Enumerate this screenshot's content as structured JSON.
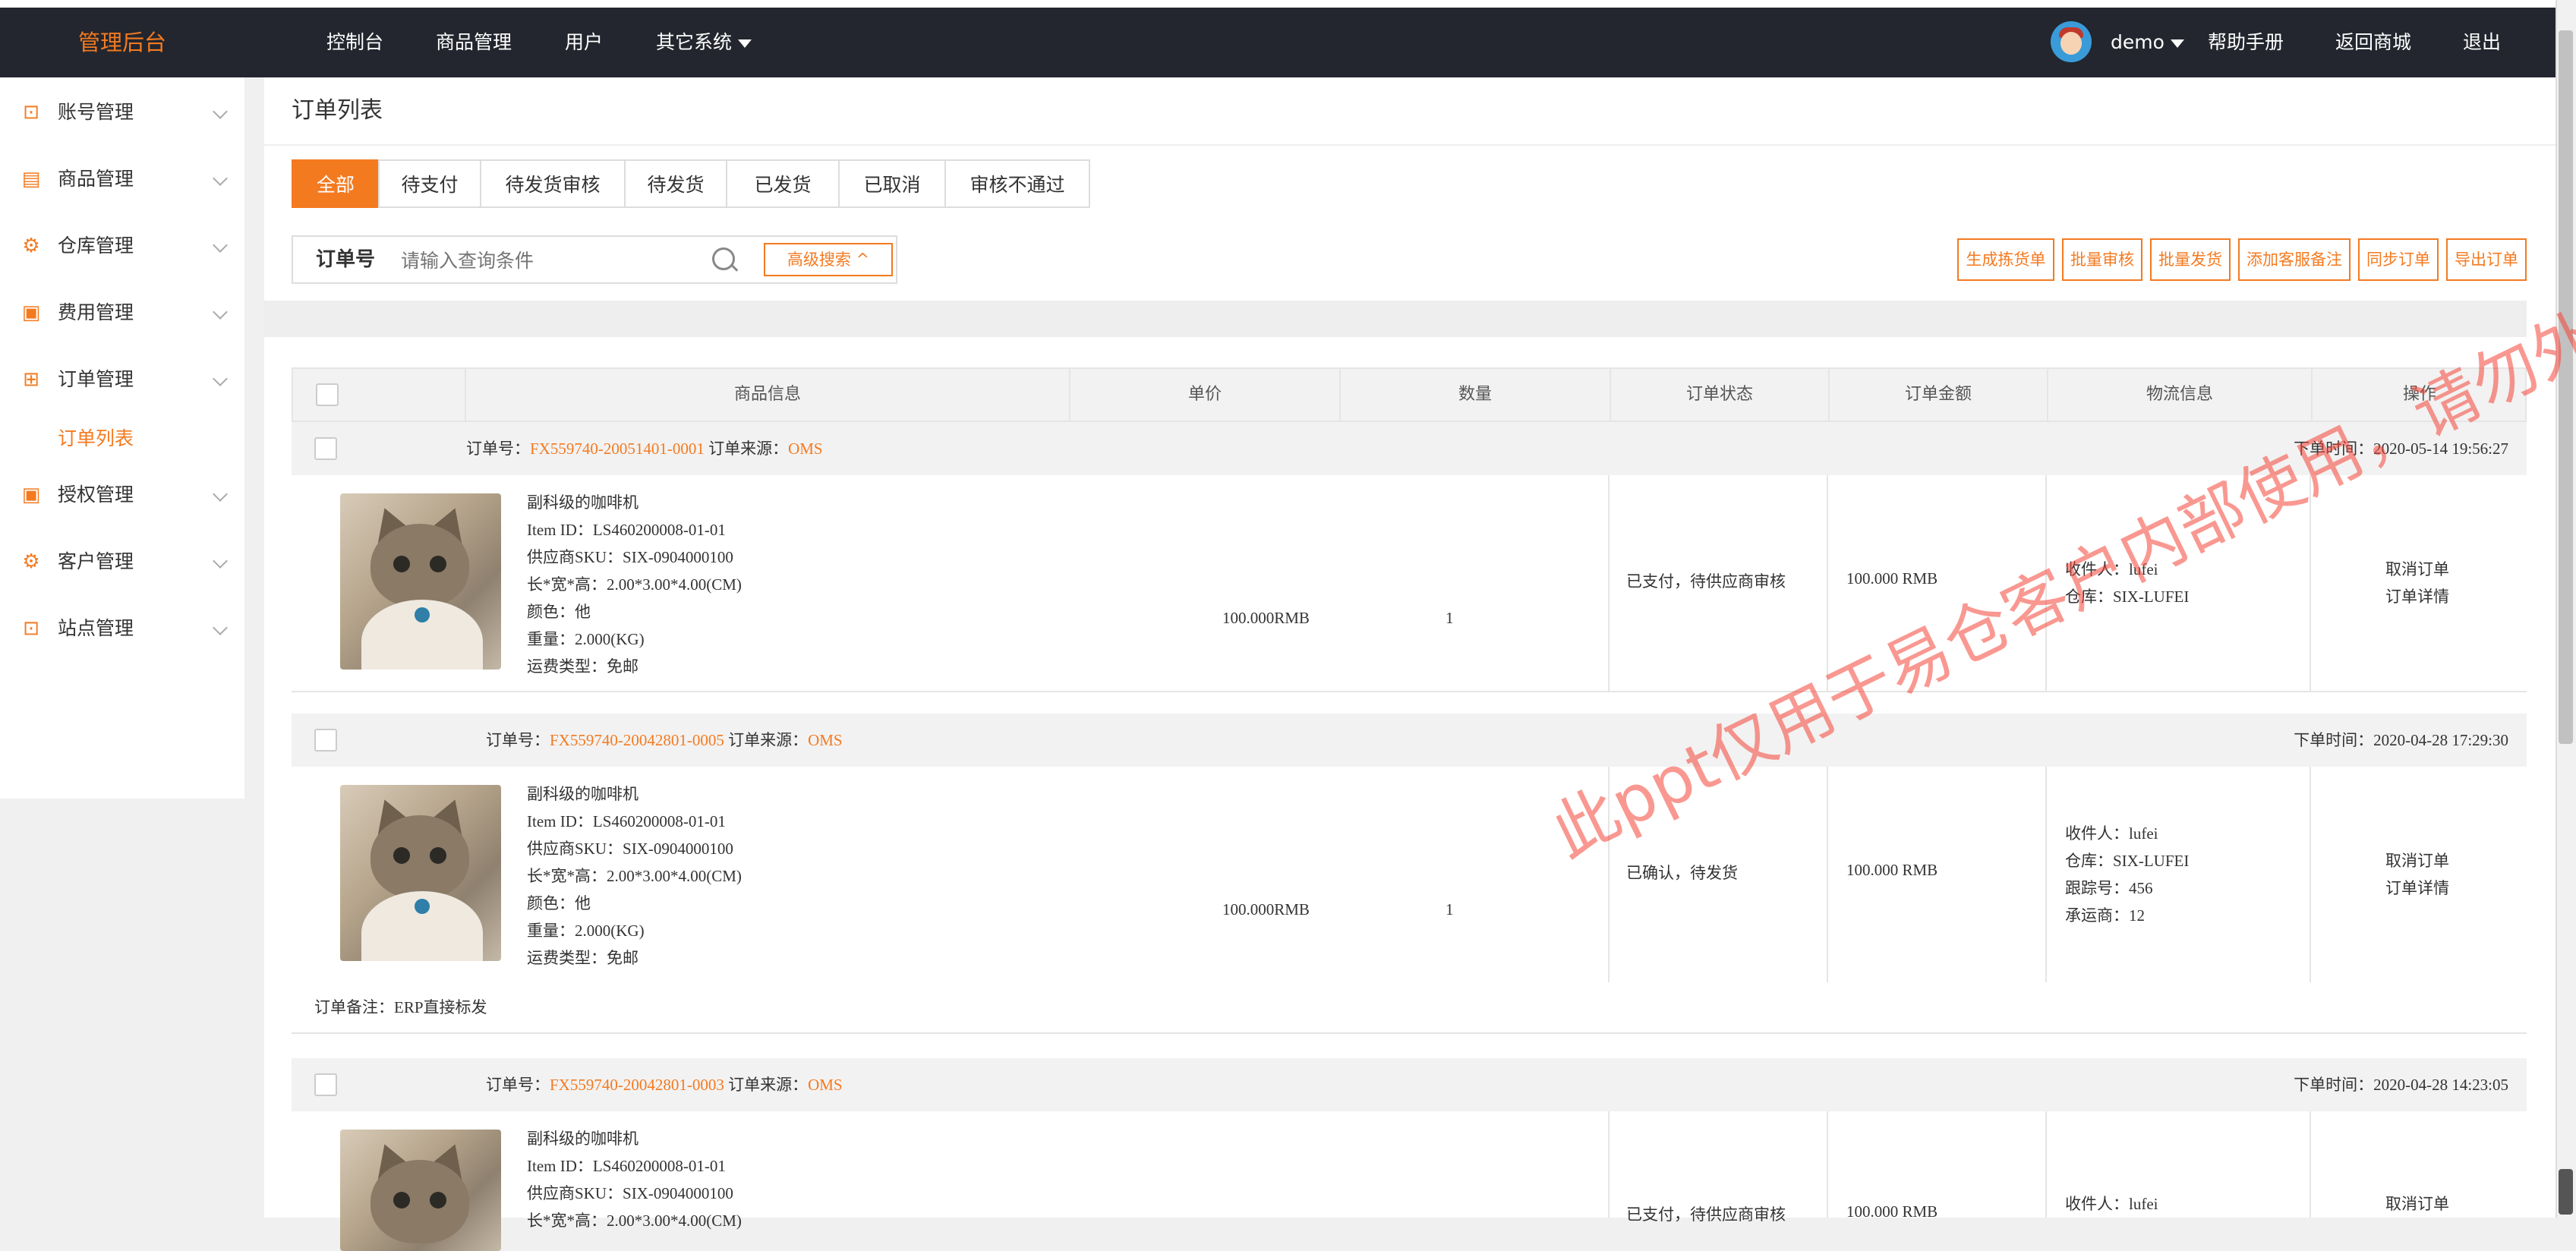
{
  "header": {
    "brand": "管理后台",
    "nav": [
      "控制台",
      "商品管理",
      "用户",
      "其它系统"
    ],
    "user": "demo",
    "help": "帮助手册",
    "back_mall": "返回商城",
    "logout": "退出"
  },
  "sidebar": {
    "items": [
      {
        "label": "账号管理",
        "icon": "chart-icon"
      },
      {
        "label": "商品管理",
        "icon": "id-card-icon"
      },
      {
        "label": "仓库管理",
        "icon": "gear-icon"
      },
      {
        "label": "费用管理",
        "icon": "calendar-icon"
      },
      {
        "label": "订单管理",
        "icon": "gift-icon"
      },
      {
        "label": "授权管理",
        "icon": "calendar-icon"
      },
      {
        "label": "客户管理",
        "icon": "gear-icon"
      },
      {
        "label": "站点管理",
        "icon": "chart-icon"
      }
    ],
    "active_sub": "订单列表"
  },
  "page": {
    "title": "订单列表"
  },
  "tabs": [
    "全部",
    "待支付",
    "待发货审核",
    "待发货",
    "已发货",
    "已取消",
    "审核不通过"
  ],
  "search": {
    "label": "订单号",
    "placeholder": "请输入查询条件",
    "advanced": "高级搜索 ^"
  },
  "actions": [
    "生成拣货单",
    "批量审核",
    "批量发货",
    "添加客服备注",
    "同步订单",
    "导出订单"
  ],
  "table": {
    "headers": [
      "商品信息",
      "单价",
      "数量",
      "订单状态",
      "订单金额",
      "物流信息",
      "操作"
    ]
  },
  "labels": {
    "order_no": "订单号：",
    "order_source": " 订单来源：",
    "order_time": "下单时间：",
    "cancel": "取消订单",
    "detail": "订单详情"
  },
  "orders": [
    {
      "order_no": "FX559740-20051401-0001",
      "source": "OMS",
      "time": "2020-05-14 19:56:27",
      "product": {
        "name": "副科级的咖啡机",
        "item_id": "Item ID：LS460200008-01-01",
        "sku": "供应商SKU：SIX-0904000100",
        "dims": "长*宽*高：2.00*3.00*4.00(CM)",
        "color": "颜色：他",
        "weight": "重量：2.000(KG)",
        "shipping": "运费类型：免邮"
      },
      "price": "100.000RMB",
      "qty": "1",
      "status": "已支付，待供应商审核",
      "amount": "100.000 RMB",
      "logistics": [
        "收件人：lufei",
        "仓库：SIX-LUFEI"
      ]
    },
    {
      "order_no": "FX559740-20042801-0005",
      "source": "OMS",
      "time": "2020-04-28 17:29:30",
      "product": {
        "name": "副科级的咖啡机",
        "item_id": "Item ID：LS460200008-01-01",
        "sku": "供应商SKU：SIX-0904000100",
        "dims": "长*宽*高：2.00*3.00*4.00(CM)",
        "color": "颜色：他",
        "weight": "重量：2.000(KG)",
        "shipping": "运费类型：免邮"
      },
      "price": "100.000RMB",
      "qty": "1",
      "status": "已确认，待发货",
      "amount": "100.000 RMB",
      "logistics": [
        "收件人：lufei",
        "仓库：SIX-LUFEI",
        "跟踪号：456",
        "承运商：12"
      ],
      "remark": "订单备注：ERP直接标发"
    },
    {
      "order_no": "FX559740-20042801-0003",
      "source": "OMS",
      "time": "2020-04-28 14:23:05",
      "product": {
        "name": "副科级的咖啡机",
        "item_id": "Item ID：LS460200008-01-01",
        "sku": "供应商SKU：SIX-0904000100",
        "dims": "长*宽*高：2.00*3.00*4.00(CM)"
      },
      "status": "已支付，待供应商审核",
      "amount": "100.000 RMB",
      "logistics": [
        "收件人：lufei"
      ]
    }
  ],
  "watermark": "此ppt仅用于易仓客户内部使用，请勿外传",
  "colors": {
    "accent": "#f47a20",
    "topbar": "#23262e"
  }
}
